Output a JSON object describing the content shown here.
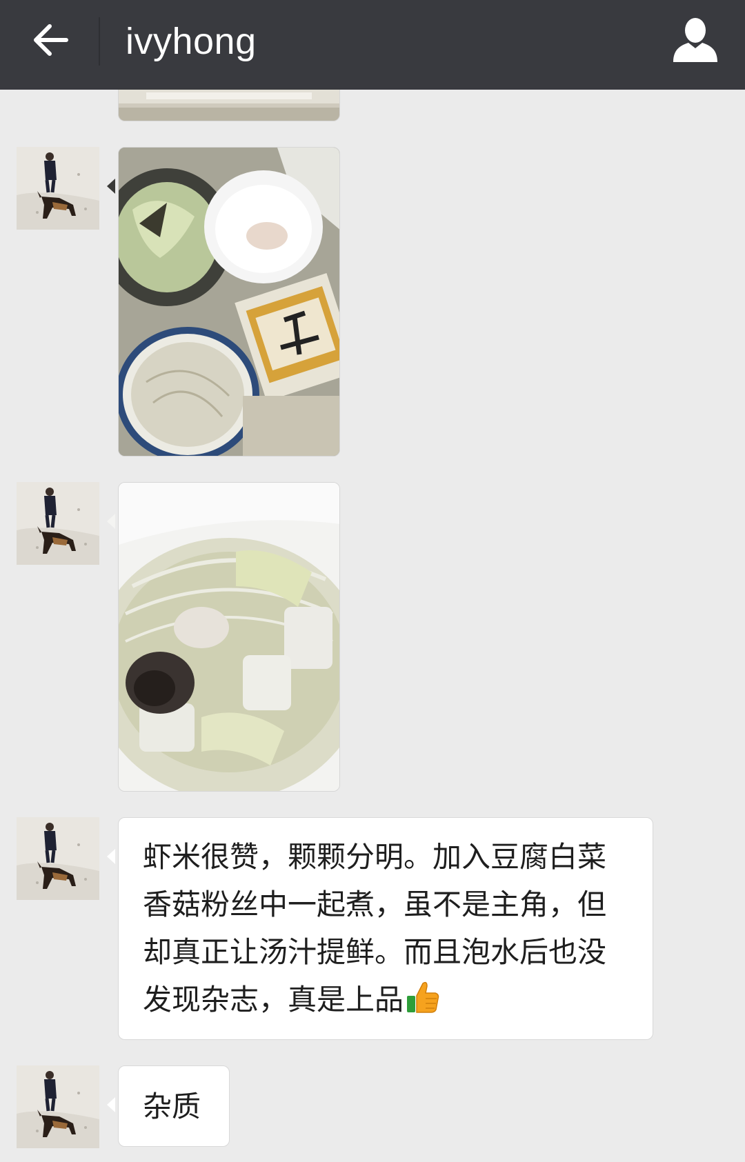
{
  "header": {
    "title": "ivyhong",
    "back_icon": "arrow-left-icon",
    "profile_icon": "person-icon",
    "bg_color": "#393a3f"
  },
  "messages": [
    {
      "type": "image",
      "content": "food photo (partially visible)"
    },
    {
      "type": "image",
      "content": "ingredients photo: napa cabbage, bowl of dried shrimp, bowl of glass noodles, tofu box"
    },
    {
      "type": "image",
      "content": "soup photo: tofu, cabbage, shiitake mushroom, glass noodles"
    },
    {
      "type": "text",
      "text": "虾米很赞，颗颗分明。加入豆腐白菜香菇粉丝中一起煮，虽不是主角，但却真正让汤汁提鲜。而且泡水后也没发现杂志，真是上品",
      "emoji": "thumbs-up-icon"
    },
    {
      "type": "text",
      "text": "杂质"
    }
  ]
}
